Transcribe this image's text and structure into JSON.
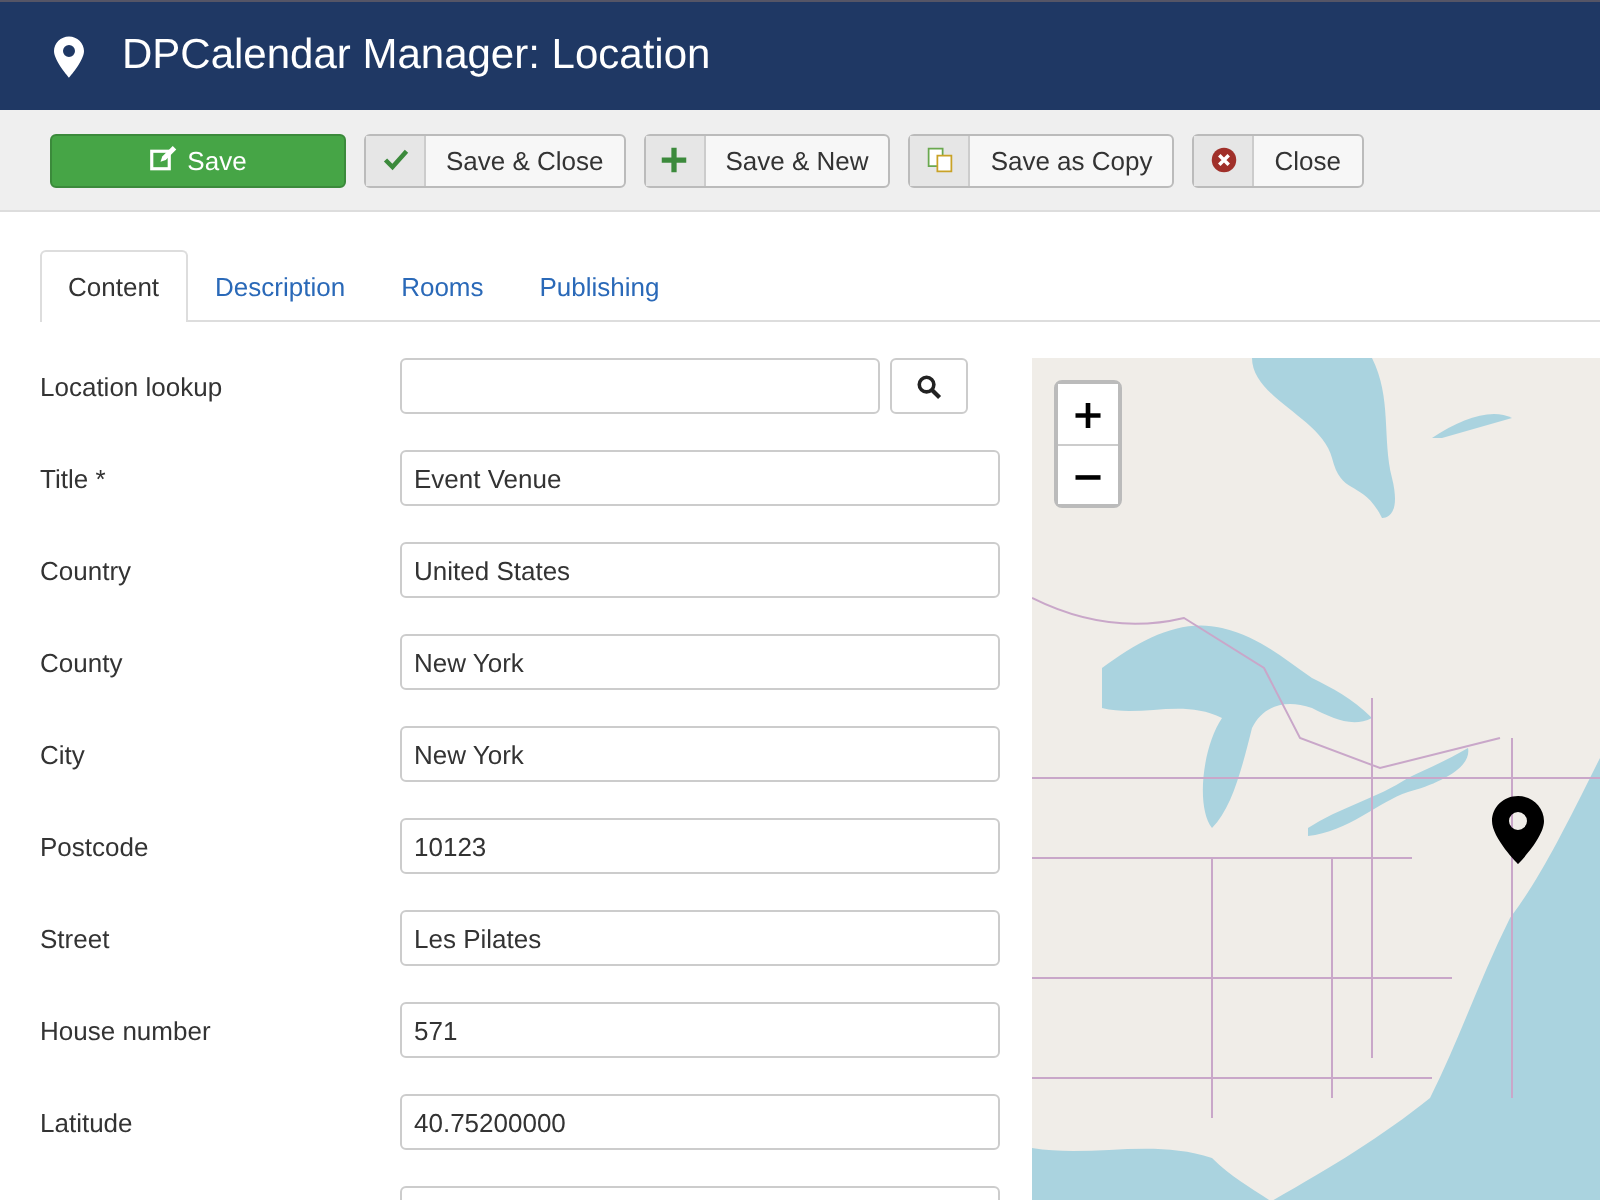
{
  "header": {
    "title": "DPCalendar Manager: Location"
  },
  "toolbar": [
    {
      "label": "Save",
      "kind": "primary"
    },
    {
      "label": "Save & Close",
      "kind": "default"
    },
    {
      "label": "Save & New",
      "kind": "default"
    },
    {
      "label": "Save as Copy",
      "kind": "default"
    },
    {
      "label": "Close",
      "kind": "default"
    }
  ],
  "tabs": [
    {
      "label": "Content",
      "selected": true
    },
    {
      "label": "Description",
      "selected": false
    },
    {
      "label": "Rooms",
      "selected": false
    },
    {
      "label": "Publishing",
      "selected": false
    }
  ],
  "fields": [
    {
      "label": "Location lookup",
      "kind": "lookup"
    },
    {
      "label": "Title *",
      "value": "Event Venue",
      "kind": "text"
    },
    {
      "label": "Country",
      "value": "United States",
      "kind": "text"
    },
    {
      "label": "County",
      "value": "New York",
      "kind": "text"
    },
    {
      "label": "City",
      "value": "New York",
      "kind": "text"
    },
    {
      "label": "Postcode",
      "value": "10123",
      "kind": "text"
    },
    {
      "label": "Street",
      "value": "Les Pilates",
      "kind": "text"
    },
    {
      "label": "House number",
      "value": "571",
      "kind": "text"
    },
    {
      "label": "Latitude",
      "value": "40.75200000",
      "kind": "text"
    },
    {
      "kind": "text"
    }
  ],
  "map": {
    "zoom_in": "+",
    "zoom_out": "−"
  }
}
